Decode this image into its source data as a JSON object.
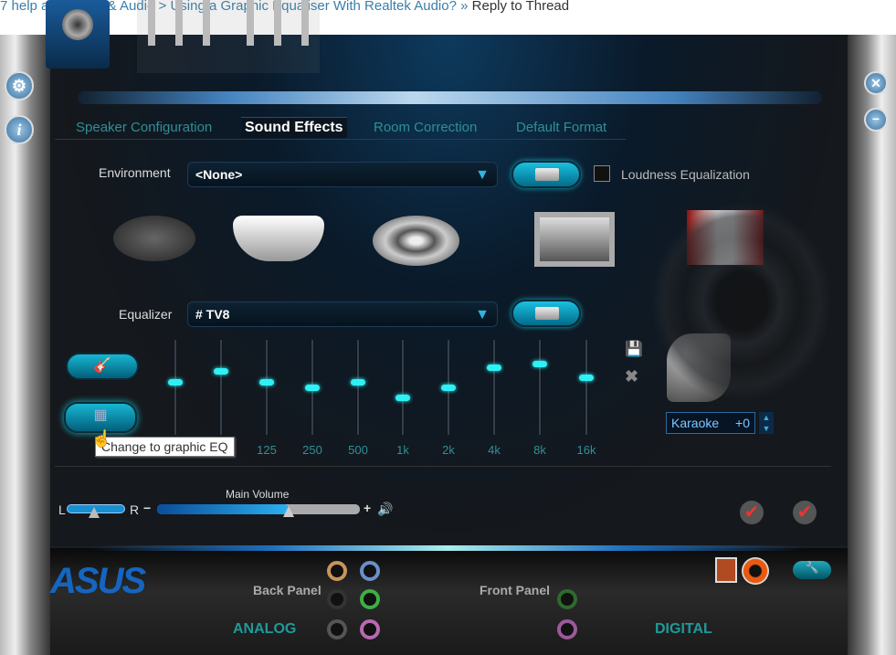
{
  "breadcrumb": {
    "prefix": "7 help a",
    "items": [
      "Sound & Audio",
      "Using a Graphic Equaliser With Realtek Audio?"
    ],
    "current": "Reply to Thread"
  },
  "tabs": [
    {
      "label": "Speaker Configuration",
      "active": false
    },
    {
      "label": "Sound Effects",
      "active": true
    },
    {
      "label": "Room Correction",
      "active": false
    },
    {
      "label": "Default Format",
      "active": false
    }
  ],
  "environment": {
    "label": "Environment",
    "value": "<None>",
    "loudness_label": "Loudness Equalization",
    "loudness_checked": false,
    "icons": [
      "stone-disc-icon",
      "bathtub-icon",
      "colosseum-icon",
      "room-box-icon",
      "theater-stage-icon"
    ]
  },
  "equalizer": {
    "label": "Equalizer",
    "value": "# TV8",
    "bands": [
      {
        "freq": "",
        "level": 0.55
      },
      {
        "freq": "",
        "level": 0.67
      },
      {
        "freq": "125",
        "level": 0.55
      },
      {
        "freq": "250",
        "level": 0.5
      },
      {
        "freq": "500",
        "level": 0.55
      },
      {
        "freq": "1k",
        "level": 0.39
      },
      {
        "freq": "2k",
        "level": 0.5
      },
      {
        "freq": "4k",
        "level": 0.71
      },
      {
        "freq": "8k",
        "level": 0.75
      },
      {
        "freq": "16k",
        "level": 0.6
      }
    ],
    "tooltip": "Change to graphic EQ"
  },
  "karaoke": {
    "label": "Karaoke",
    "value": "+0"
  },
  "volume": {
    "label": "Main Volume",
    "left": "L",
    "right": "R",
    "minus": "−",
    "plus": "+",
    "level": 0.65,
    "balance": 0.45
  },
  "footer": {
    "logo": "ASUS",
    "back_panel": "Back Panel",
    "front_panel": "Front Panel",
    "analog": "ANALOG",
    "digital": "DIGITAL"
  },
  "colors": {
    "accent": "#2ff0f5",
    "tab_text": "#2f8f95",
    "brand": "#1565c0"
  }
}
